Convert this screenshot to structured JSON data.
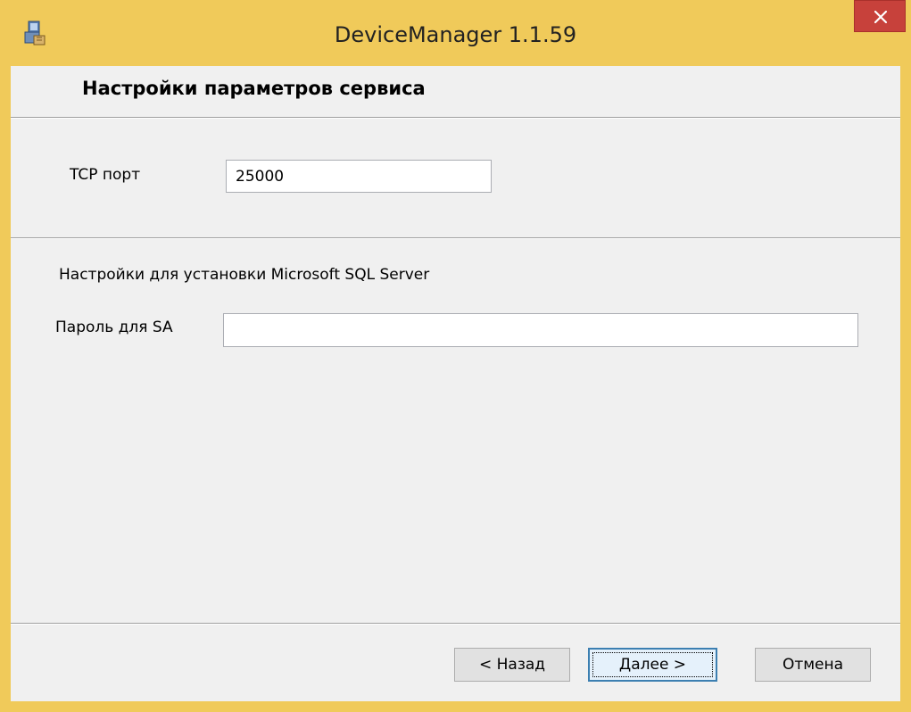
{
  "window": {
    "title": "DeviceManager 1.1.59",
    "icon": "installer-icon",
    "close_glyph": "✕",
    "accent_color": "#f0ca5a"
  },
  "header": {
    "title": "Настройки параметров сервиса"
  },
  "service": {
    "tcp_port_label": "TCP порт",
    "tcp_port_value": "25000"
  },
  "sql": {
    "section_label": "Настройки для установки Microsoft SQL Server",
    "sa_password_label": "Пароль для  SA",
    "sa_password_value": ""
  },
  "buttons": {
    "back_label": "< Назад",
    "next_label": "Далее >",
    "cancel_label": "Отмена"
  }
}
